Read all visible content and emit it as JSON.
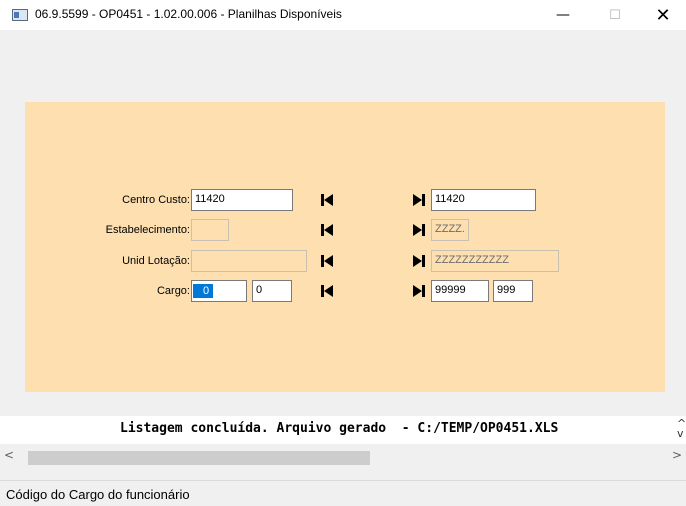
{
  "window": {
    "title": "06.9.5599 - OP0451 - 1.02.00.006 - Planilhas Disponíveis",
    "minimize_glyph": "—",
    "maximize_glyph": "☐",
    "close_glyph": "✕"
  },
  "form": {
    "centro_custo": {
      "label": "Centro Custo:",
      "from": "11420",
      "to": "11420"
    },
    "estabelecimento": {
      "label": "Estabelecimento:",
      "from": "",
      "to": "ZZZZ."
    },
    "unid_lotacao": {
      "label": "Unid Lotação:",
      "from": "",
      "to": "ZZZZZZZZZZZ"
    },
    "cargo": {
      "label": "Cargo:",
      "from_1": "0",
      "from_2": "0",
      "to_1": "99999",
      "to_2": "999"
    }
  },
  "icons": {
    "first": "first-record-icon",
    "last": "last-record-icon"
  },
  "status_message": "Listagem concluída. Arquivo gerado  - C:/TEMP/OP0451.XLS",
  "scroll": {
    "left": "<",
    "right": ">",
    "vertical": "^\nv"
  },
  "statusbar": {
    "text": "Código do Cargo do funcionário"
  },
  "colors": {
    "panel": "#fddfb0",
    "selection": "#0078d7"
  }
}
